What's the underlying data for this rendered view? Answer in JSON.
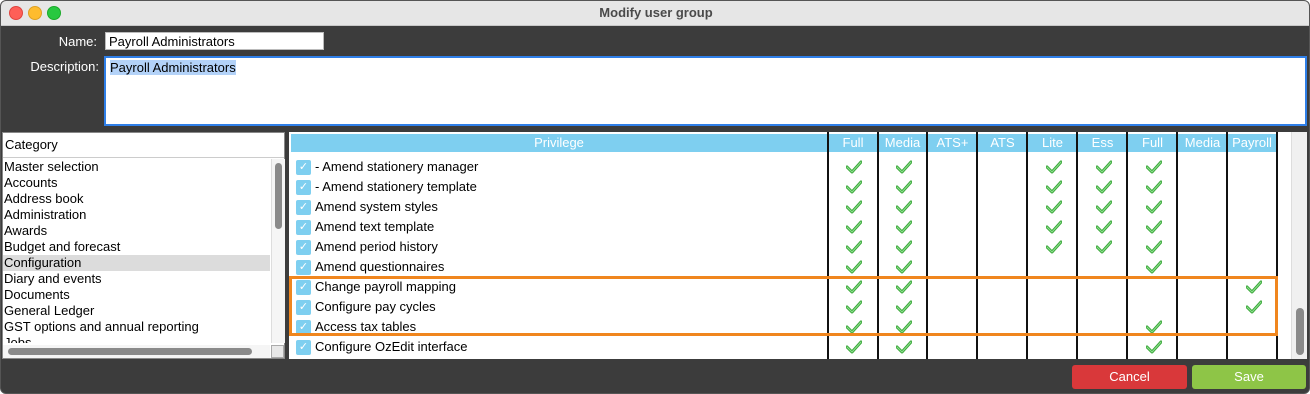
{
  "window": {
    "title": "Modify user group"
  },
  "form": {
    "name_label": "Name:",
    "name_value": "Payroll Administrators",
    "description_label": "Description:",
    "description_value": "Payroll Administrators"
  },
  "category": {
    "header": "Category",
    "items": [
      "Master selection",
      "Accounts",
      "Address book",
      "Administration",
      "Awards",
      "Budget and forecast",
      "Configuration",
      "Diary and events",
      "Documents",
      "General Ledger",
      "GST options and annual reporting",
      "Jobs"
    ],
    "selected": "Configuration"
  },
  "privileges": {
    "columns": [
      "Privilege",
      "Full",
      "Media",
      "ATS+",
      "ATS",
      "Lite",
      "Ess",
      "Full",
      "Media",
      "Payroll"
    ],
    "rows": [
      {
        "label": " - Amend stationery manager",
        "checks": [
          true,
          true,
          false,
          false,
          true,
          true,
          true,
          false,
          false
        ]
      },
      {
        "label": " - Amend stationery template",
        "checks": [
          true,
          true,
          false,
          false,
          true,
          true,
          true,
          false,
          false
        ]
      },
      {
        "label": "Amend system styles",
        "checks": [
          true,
          true,
          false,
          false,
          true,
          true,
          true,
          false,
          false
        ]
      },
      {
        "label": "Amend text template",
        "checks": [
          true,
          true,
          false,
          false,
          true,
          true,
          true,
          false,
          false
        ]
      },
      {
        "label": "Amend period history",
        "checks": [
          true,
          true,
          false,
          false,
          true,
          true,
          true,
          false,
          false
        ]
      },
      {
        "label": "Amend questionnaires",
        "checks": [
          true,
          true,
          false,
          false,
          false,
          false,
          true,
          false,
          false
        ]
      },
      {
        "label": "Change payroll mapping",
        "checks": [
          true,
          true,
          false,
          false,
          false,
          false,
          false,
          false,
          true
        ]
      },
      {
        "label": "Configure pay cycles",
        "checks": [
          true,
          true,
          false,
          false,
          false,
          false,
          false,
          false,
          true
        ]
      },
      {
        "label": "Access tax tables",
        "checks": [
          true,
          true,
          false,
          false,
          false,
          false,
          true,
          false,
          false
        ]
      },
      {
        "label": "Configure OzEdit interface",
        "checks": [
          true,
          true,
          false,
          false,
          false,
          false,
          true,
          false,
          false
        ]
      }
    ]
  },
  "buttons": {
    "cancel": "Cancel",
    "save": "Save"
  },
  "colors": {
    "header_bg": "#7ecff0",
    "highlight": "#f0861e",
    "cancel": "#d9383a",
    "save": "#8ec547",
    "check": "#3aa63a"
  }
}
